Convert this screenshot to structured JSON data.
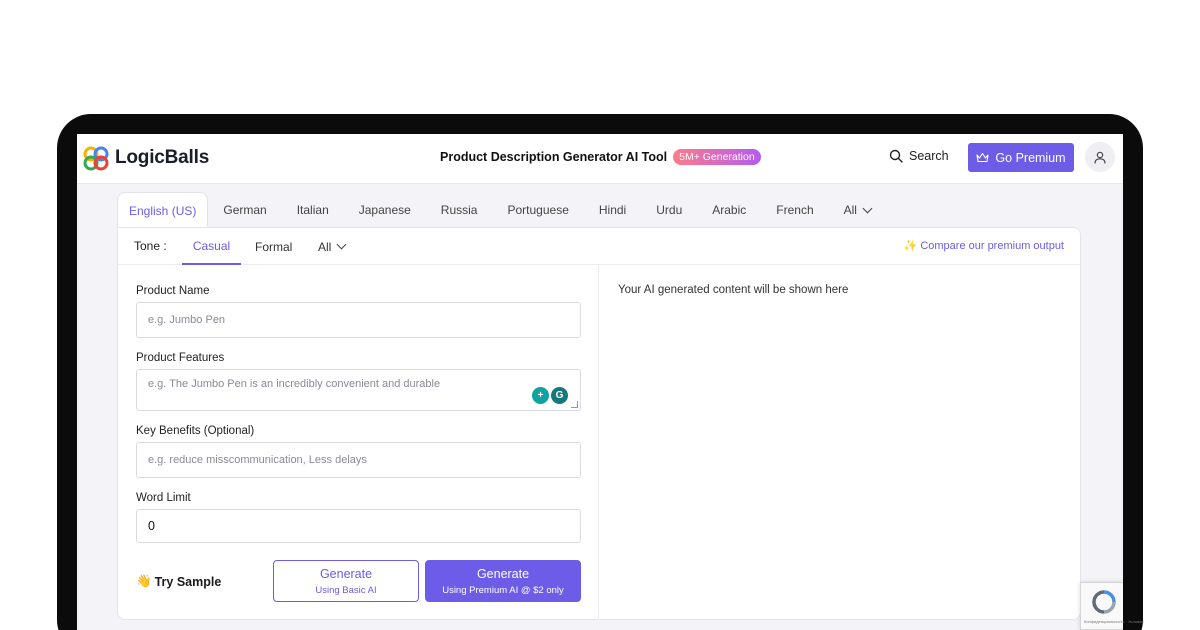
{
  "header": {
    "brand": "LogicBalls",
    "title": "Product Description Generator AI Tool",
    "badge": "5M+ Generation",
    "search_label": "Search",
    "premium_label": "Go Premium"
  },
  "languages": {
    "tabs": [
      "English (US)",
      "German",
      "Italian",
      "Japanese",
      "Russia",
      "Portuguese",
      "Hindi",
      "Urdu",
      "Arabic",
      "French"
    ],
    "all_label": "All",
    "active_index": 0
  },
  "tone": {
    "label": "Tone :",
    "options": [
      "Casual",
      "Formal"
    ],
    "all_label": "All",
    "active": "Casual",
    "compare_link": "✨ Compare our premium output"
  },
  "form": {
    "product_name": {
      "label": "Product Name",
      "placeholder": "e.g. Jumbo Pen"
    },
    "product_features": {
      "label": "Product Features",
      "placeholder": "e.g. The Jumbo Pen is an incredibly convenient and durable"
    },
    "key_benefits": {
      "label": "Key Benefits (Optional)",
      "placeholder": "e.g. reduce misscommunication, Less delays"
    },
    "word_limit": {
      "label": "Word Limit",
      "value": "0"
    }
  },
  "actions": {
    "try_sample": "Try Sample",
    "generate_basic": {
      "label": "Generate",
      "sublabel": "Using Basic AI"
    },
    "generate_premium": {
      "label": "Generate",
      "sublabel": "Using Premium AI @ $2 only"
    }
  },
  "output": {
    "placeholder": "Your AI generated content will be shown here"
  },
  "recaptcha": {
    "text": "Конфиденциальность · Условия"
  },
  "colors": {
    "accent": "#6c5ce7",
    "badge_start": "#ff7a8a",
    "badge_end": "#b45cf0",
    "device": "#0b0b0c",
    "screen_bg": "#f3f3f8"
  },
  "icons": [
    "logicballs-logo-icon",
    "search-icon",
    "crown-icon",
    "user-icon",
    "chevron-down-icon",
    "waving-hand-icon",
    "grammarly-icon",
    "recaptcha-icon"
  ]
}
